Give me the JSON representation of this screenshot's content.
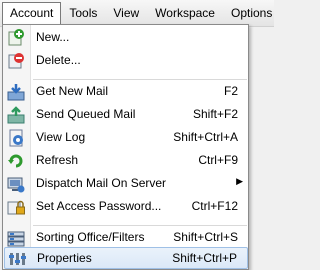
{
  "menubar": {
    "items": [
      "Account",
      "Tools",
      "View",
      "Workspace",
      "Options"
    ]
  },
  "menu": {
    "new": {
      "label": "New...",
      "icon": "add-icon"
    },
    "delete": {
      "label": "Delete...",
      "icon": "delete-icon"
    },
    "get_new_mail": {
      "label": "Get New Mail",
      "shortcut": "F2",
      "icon": "get-mail-icon"
    },
    "send_queued_mail": {
      "label": "Send Queued Mail",
      "shortcut": "Shift+F2",
      "icon": "send-mail-icon"
    },
    "view_log": {
      "label": "View Log",
      "shortcut": "Shift+Ctrl+A",
      "icon": "log-icon"
    },
    "refresh": {
      "label": "Refresh",
      "shortcut": "Ctrl+F9",
      "icon": "refresh-icon"
    },
    "dispatch": {
      "label": "Dispatch Mail On Server",
      "icon": "dispatch-icon"
    },
    "set_access_password": {
      "label": "Set Access Password...",
      "shortcut": "Ctrl+F12",
      "icon": "lock-icon"
    },
    "sorting": {
      "label": "Sorting Office/Filters",
      "shortcut": "Shift+Ctrl+S",
      "icon": "filter-icon"
    },
    "properties": {
      "label": "Properties",
      "shortcut": "Shift+Ctrl+P",
      "icon": "properties-icon"
    }
  },
  "colors": {
    "highlight_border": "#9fc0e6",
    "highlight_fill": "#dbe8f7"
  }
}
